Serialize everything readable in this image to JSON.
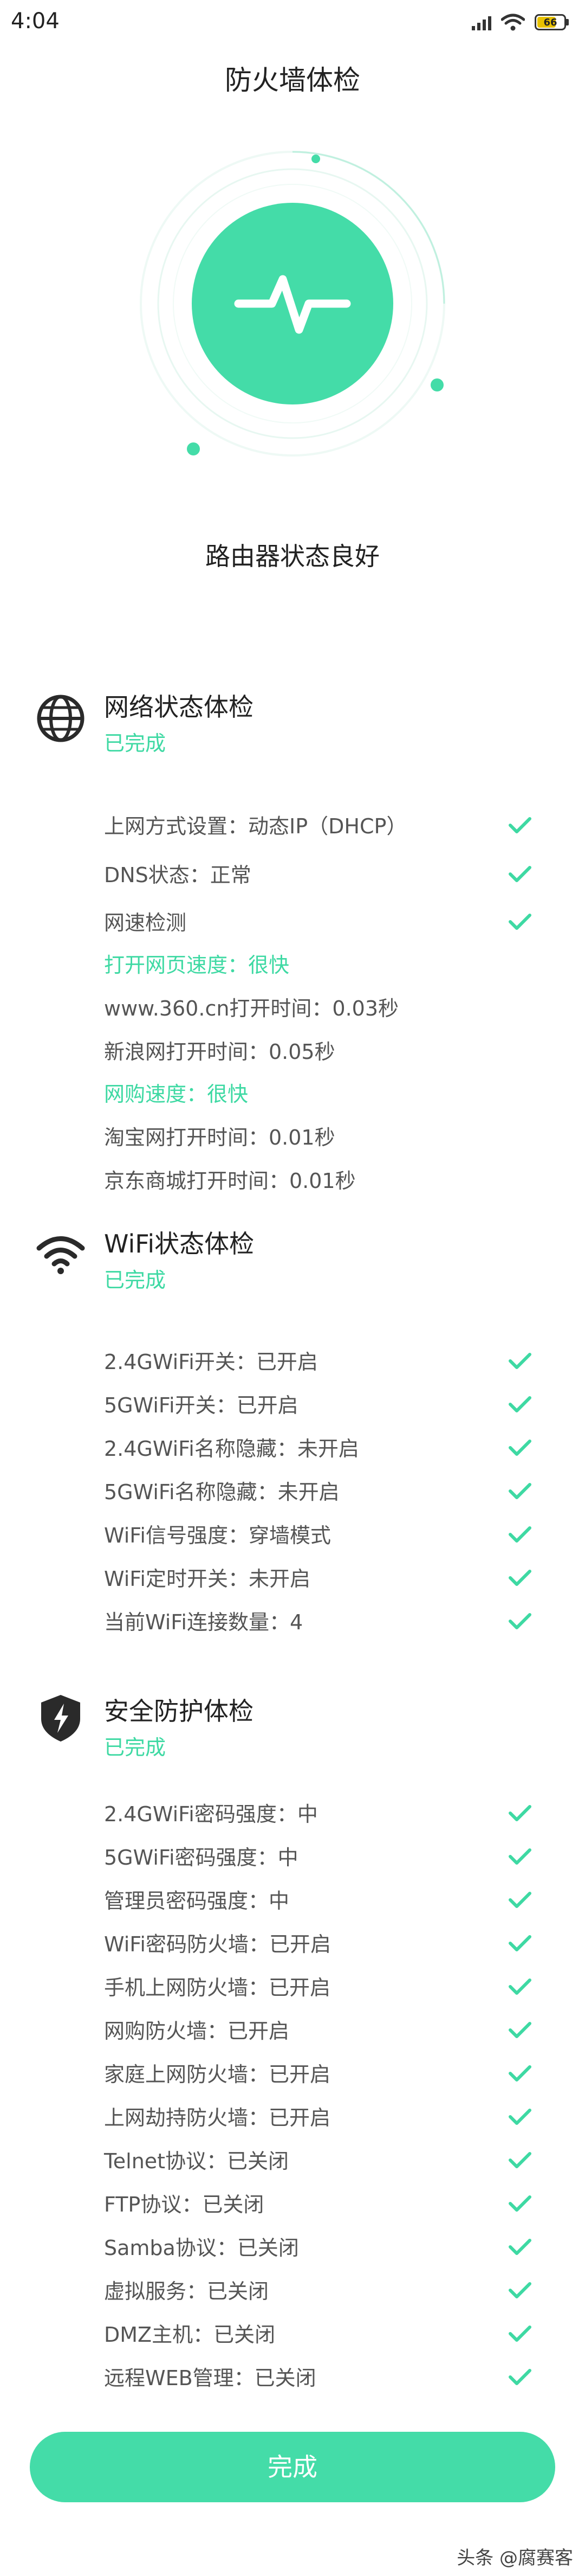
{
  "status_bar": {
    "time": "4:04",
    "battery": "66"
  },
  "title": "防火墙体检",
  "hero": {
    "status_text": "路由器状态良好"
  },
  "sections": [
    {
      "icon": "globe-icon",
      "title": "网络状态体检",
      "status": "已完成",
      "items": [
        {
          "label": "上网方式设置：动态IP（DHCP）",
          "checked": true
        },
        {
          "label": "DNS状态：正常",
          "checked": true
        },
        {
          "label": "网速检测",
          "checked": true
        },
        {
          "label": "打开网页速度：很快",
          "highlight": true
        },
        {
          "label": "www.360.cn打开时间：0.03秒"
        },
        {
          "label": "新浪网打开时间：0.05秒"
        },
        {
          "label": "网购速度：很快",
          "highlight": true
        },
        {
          "label": "淘宝网打开时间：0.01秒"
        },
        {
          "label": "京东商城打开时间：0.01秒"
        }
      ]
    },
    {
      "icon": "wifi-icon",
      "title": "WiFi状态体检",
      "status": "已完成",
      "items": [
        {
          "label": "2.4GWiFi开关：已开启",
          "checked": true
        },
        {
          "label": "5GWiFi开关：已开启",
          "checked": true
        },
        {
          "label": "2.4GWiFi名称隐藏：未开启",
          "checked": true
        },
        {
          "label": "5GWiFi名称隐藏：未开启",
          "checked": true
        },
        {
          "label": "WiFi信号强度：穿墙模式",
          "checked": true
        },
        {
          "label": "WiFi定时开关：未开启",
          "checked": true
        },
        {
          "label": "当前WiFi连接数量：4",
          "checked": true
        }
      ]
    },
    {
      "icon": "shield-bolt-icon",
      "title": "安全防护体检",
      "status": "已完成",
      "items": [
        {
          "label": "2.4GWiFi密码强度：中",
          "checked": true
        },
        {
          "label": "5GWiFi密码强度：中",
          "checked": true
        },
        {
          "label": "管理员密码强度：中",
          "checked": true
        },
        {
          "label": "WiFi密码防火墙：已开启",
          "checked": true
        },
        {
          "label": "手机上网防火墙：已开启",
          "checked": true
        },
        {
          "label": "网购防火墙：已开启",
          "checked": true
        },
        {
          "label": "家庭上网防火墙：已开启",
          "checked": true
        },
        {
          "label": "上网劫持防火墙：已开启",
          "checked": true
        },
        {
          "label": "Telnet协议：已关闭",
          "checked": true
        },
        {
          "label": "FTP协议：已关闭",
          "checked": true
        },
        {
          "label": "Samba协议：已关闭",
          "checked": true
        },
        {
          "label": "虚拟服务：已关闭",
          "checked": true
        },
        {
          "label": "DMZ主机：已关闭",
          "checked": true
        },
        {
          "label": "远程WEB管理：已关闭",
          "checked": true
        }
      ]
    }
  ],
  "finish_button": "完成",
  "watermark": "头条 @腐赛客",
  "colors": {
    "accent": "#3ed9a3",
    "button": "#44dca8",
    "check": "#3ed9a3"
  }
}
